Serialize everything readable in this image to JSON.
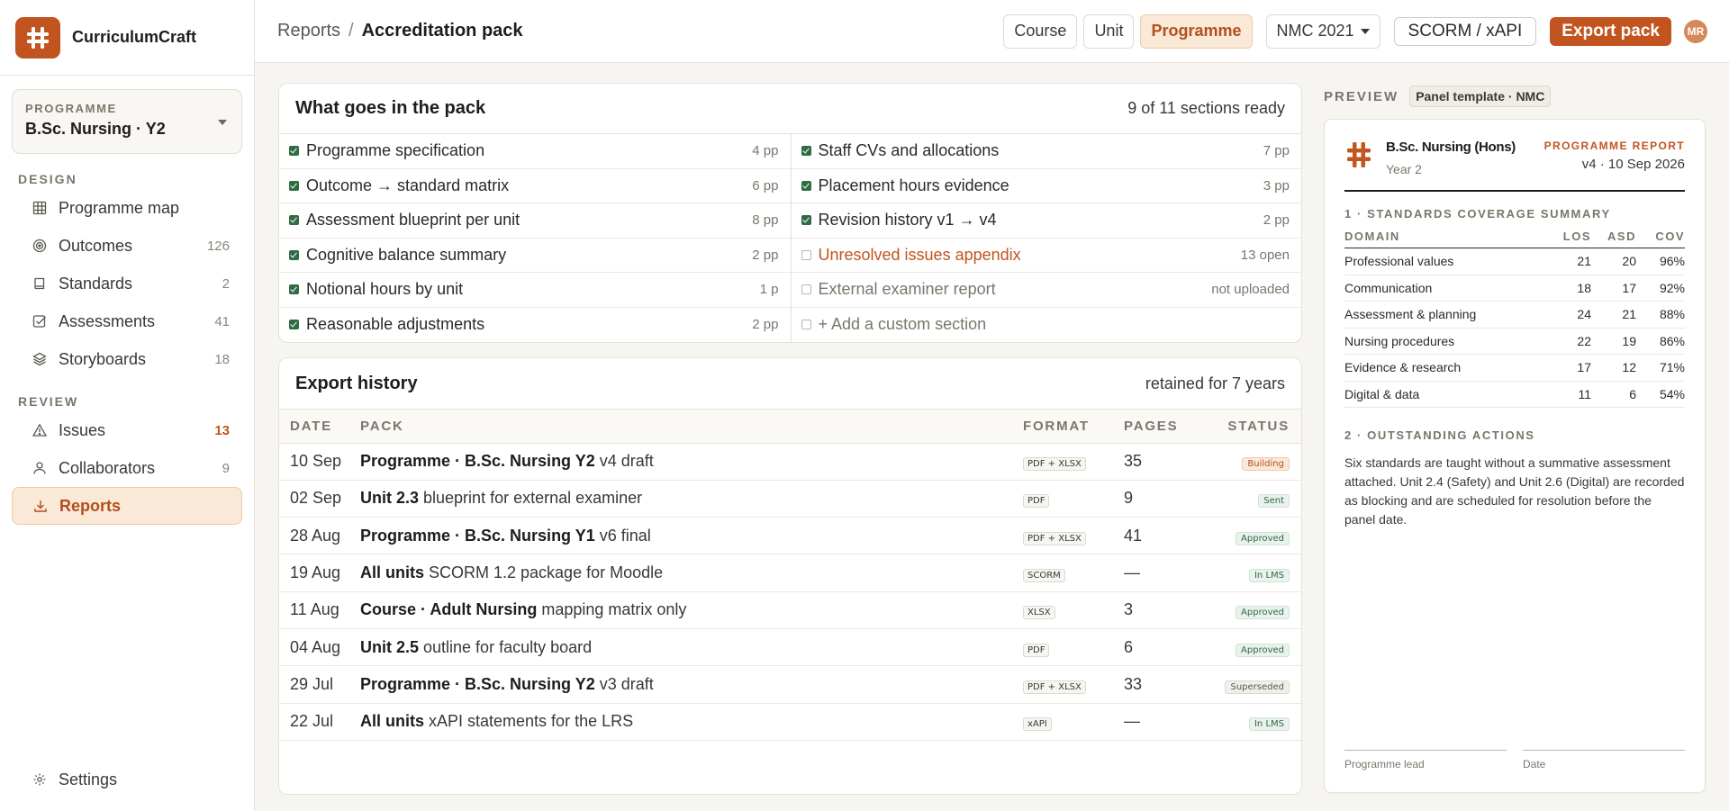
{
  "app": {
    "name": "CurriculumCraft",
    "colors": {
      "accent": "#c2541f",
      "ready": "#2f6b45"
    }
  },
  "sidebar": {
    "programme_label": "PROGRAMME",
    "programme_value": "B.Sc. Nursing · Y2",
    "design_label": "DESIGN",
    "review_label": "REVIEW",
    "design_items": [
      {
        "label": "Programme map",
        "count": "",
        "icon": "grid-icon"
      },
      {
        "label": "Outcomes",
        "count": "126",
        "icon": "target-icon"
      },
      {
        "label": "Standards",
        "count": "2",
        "icon": "book-icon"
      },
      {
        "label": "Assessments",
        "count": "41",
        "icon": "checkbox-icon"
      },
      {
        "label": "Storyboards",
        "count": "18",
        "icon": "layers-icon"
      }
    ],
    "review_items": [
      {
        "label": "Issues",
        "count": "13",
        "icon": "warning-icon"
      },
      {
        "label": "Collaborators",
        "count": "9",
        "icon": "user-icon"
      },
      {
        "label": "Reports",
        "count": "",
        "icon": "download-icon"
      }
    ],
    "settings_label": "Settings"
  },
  "topbar": {
    "breadcrumb_parent": "Reports",
    "breadcrumb_sep": "/",
    "breadcrumb_current": "Accreditation pack",
    "scope": [
      "Course",
      "Unit",
      "Programme"
    ],
    "standard": "NMC 2021",
    "format_button": "SCORM / xAPI",
    "export_button": "Export pack",
    "avatar": "MR"
  },
  "pack": {
    "title": "What goes in the pack",
    "status": "9 of 11 sections ready",
    "left": [
      {
        "name": "Programme specification",
        "pages": "4 pp"
      },
      {
        "name": "Outcome → standard matrix",
        "pages": "6 pp"
      },
      {
        "name": "Assessment blueprint per unit",
        "pages": "8 pp"
      },
      {
        "name": "Cognitive balance summary",
        "pages": "2 pp"
      },
      {
        "name": "Notional hours by unit",
        "pages": "1 p"
      },
      {
        "name": "Reasonable adjustments",
        "pages": "2 pp"
      }
    ],
    "right": [
      {
        "name": "Staff CVs and allocations",
        "pages": "7 pp"
      },
      {
        "name": "Placement hours evidence",
        "pages": "3 pp"
      },
      {
        "name": "Revision history v1 → v4",
        "pages": "2 pp"
      },
      {
        "name": "Unresolved issues appendix",
        "pages": "13 open"
      },
      {
        "name": "External examiner report",
        "pages": "not uploaded"
      },
      {
        "name": "+ Add a custom section",
        "pages": ""
      }
    ]
  },
  "history": {
    "title": "Export history",
    "retention": "retained for 7 years",
    "columns": [
      "DATE",
      "PACK",
      "FORMAT",
      "PAGES",
      "STATUS"
    ],
    "rows": [
      {
        "date": "10 Sep",
        "pack_bold": "Programme · B.Sc. Nursing Y2",
        "pack_rest": " v4 draft",
        "format": "PDF + XLSX",
        "pages": "35",
        "status": "Building"
      },
      {
        "date": "02 Sep",
        "pack_bold": "Unit 2.3",
        "pack_rest": " blueprint for external examiner",
        "format": "PDF",
        "pages": "9",
        "status": "Sent"
      },
      {
        "date": "28 Aug",
        "pack_bold": "Programme · B.Sc. Nursing Y1",
        "pack_rest": " v6 final",
        "format": "PDF + XLSX",
        "pages": "41",
        "status": "Approved"
      },
      {
        "date": "19 Aug",
        "pack_bold": "All units",
        "pack_rest": " SCORM 1.2 package for Moodle",
        "format": "SCORM",
        "pages": "—",
        "status": "In LMS"
      },
      {
        "date": "11 Aug",
        "pack_bold": "Course · Adult Nursing",
        "pack_rest": " mapping matrix only",
        "format": "XLSX",
        "pages": "3",
        "status": "Approved"
      },
      {
        "date": "04 Aug",
        "pack_bold": "Unit 2.5",
        "pack_rest": " outline for faculty board",
        "format": "PDF",
        "pages": "6",
        "status": "Approved"
      },
      {
        "date": "29 Jul",
        "pack_bold": "Programme · B.Sc. Nursing Y2",
        "pack_rest": " v3 draft",
        "format": "PDF + XLSX",
        "pages": "33",
        "status": "Superseded"
      },
      {
        "date": "22 Jul",
        "pack_bold": "All units",
        "pack_rest": " xAPI statements for the LRS",
        "format": "xAPI",
        "pages": "—",
        "status": "In LMS"
      }
    ]
  },
  "preview": {
    "label": "PREVIEW",
    "template": "Panel template · NMC",
    "doc_title": "B.Sc. Nursing (Hons)",
    "doc_year": "Year 2",
    "doc_kind": "PROGRAMME REPORT",
    "doc_version": "v4 · 10 Sep 2026",
    "section1": "1 · STANDARDS COVERAGE SUMMARY",
    "coverage_columns": [
      "DOMAIN",
      "LOS",
      "ASD",
      "COV"
    ],
    "coverage_rows": [
      {
        "domain": "Professional values",
        "los": "21",
        "asd": "20",
        "cov": "96%"
      },
      {
        "domain": "Communication",
        "los": "18",
        "asd": "17",
        "cov": "92%"
      },
      {
        "domain": "Assessment & planning",
        "los": "24",
        "asd": "21",
        "cov": "88%"
      },
      {
        "domain": "Nursing procedures",
        "los": "22",
        "asd": "19",
        "cov": "86%"
      },
      {
        "domain": "Evidence & research",
        "los": "17",
        "asd": "12",
        "cov": "71%"
      },
      {
        "domain": "Digital & data",
        "los": "11",
        "asd": "6",
        "cov": "54%"
      }
    ],
    "section2": "2 · OUTSTANDING ACTIONS",
    "actions_text": "Six standards are taught without a summative assessment attached. Unit 2.4 (Safety) and Unit 2.6 (Digital) are recorded as blocking and are scheduled for resolution before the panel date.",
    "sign_lead": "Programme lead",
    "sign_date": "Date"
  }
}
